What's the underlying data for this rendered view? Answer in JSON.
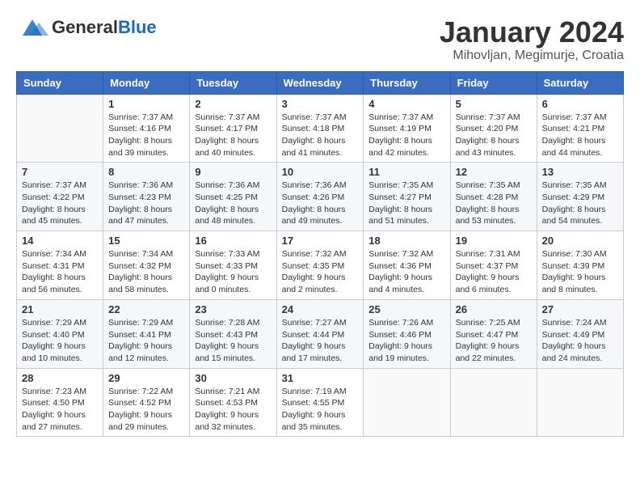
{
  "header": {
    "logo_general": "General",
    "logo_blue": "Blue",
    "title": "January 2024",
    "subtitle": "Mihovljan, Megimurje, Croatia"
  },
  "calendar": {
    "days_of_week": [
      "Sunday",
      "Monday",
      "Tuesday",
      "Wednesday",
      "Thursday",
      "Friday",
      "Saturday"
    ],
    "weeks": [
      [
        {
          "day": "",
          "info": ""
        },
        {
          "day": "1",
          "info": "Sunrise: 7:37 AM\nSunset: 4:16 PM\nDaylight: 8 hours\nand 39 minutes."
        },
        {
          "day": "2",
          "info": "Sunrise: 7:37 AM\nSunset: 4:17 PM\nDaylight: 8 hours\nand 40 minutes."
        },
        {
          "day": "3",
          "info": "Sunrise: 7:37 AM\nSunset: 4:18 PM\nDaylight: 8 hours\nand 41 minutes."
        },
        {
          "day": "4",
          "info": "Sunrise: 7:37 AM\nSunset: 4:19 PM\nDaylight: 8 hours\nand 42 minutes."
        },
        {
          "day": "5",
          "info": "Sunrise: 7:37 AM\nSunset: 4:20 PM\nDaylight: 8 hours\nand 43 minutes."
        },
        {
          "day": "6",
          "info": "Sunrise: 7:37 AM\nSunset: 4:21 PM\nDaylight: 8 hours\nand 44 minutes."
        }
      ],
      [
        {
          "day": "7",
          "info": "Sunrise: 7:37 AM\nSunset: 4:22 PM\nDaylight: 8 hours\nand 45 minutes."
        },
        {
          "day": "8",
          "info": "Sunrise: 7:36 AM\nSunset: 4:23 PM\nDaylight: 8 hours\nand 47 minutes."
        },
        {
          "day": "9",
          "info": "Sunrise: 7:36 AM\nSunset: 4:25 PM\nDaylight: 8 hours\nand 48 minutes."
        },
        {
          "day": "10",
          "info": "Sunrise: 7:36 AM\nSunset: 4:26 PM\nDaylight: 8 hours\nand 49 minutes."
        },
        {
          "day": "11",
          "info": "Sunrise: 7:35 AM\nSunset: 4:27 PM\nDaylight: 8 hours\nand 51 minutes."
        },
        {
          "day": "12",
          "info": "Sunrise: 7:35 AM\nSunset: 4:28 PM\nDaylight: 8 hours\nand 53 minutes."
        },
        {
          "day": "13",
          "info": "Sunrise: 7:35 AM\nSunset: 4:29 PM\nDaylight: 8 hours\nand 54 minutes."
        }
      ],
      [
        {
          "day": "14",
          "info": "Sunrise: 7:34 AM\nSunset: 4:31 PM\nDaylight: 8 hours\nand 56 minutes."
        },
        {
          "day": "15",
          "info": "Sunrise: 7:34 AM\nSunset: 4:32 PM\nDaylight: 8 hours\nand 58 minutes."
        },
        {
          "day": "16",
          "info": "Sunrise: 7:33 AM\nSunset: 4:33 PM\nDaylight: 9 hours\nand 0 minutes."
        },
        {
          "day": "17",
          "info": "Sunrise: 7:32 AM\nSunset: 4:35 PM\nDaylight: 9 hours\nand 2 minutes."
        },
        {
          "day": "18",
          "info": "Sunrise: 7:32 AM\nSunset: 4:36 PM\nDaylight: 9 hours\nand 4 minutes."
        },
        {
          "day": "19",
          "info": "Sunrise: 7:31 AM\nSunset: 4:37 PM\nDaylight: 9 hours\nand 6 minutes."
        },
        {
          "day": "20",
          "info": "Sunrise: 7:30 AM\nSunset: 4:39 PM\nDaylight: 9 hours\nand 8 minutes."
        }
      ],
      [
        {
          "day": "21",
          "info": "Sunrise: 7:29 AM\nSunset: 4:40 PM\nDaylight: 9 hours\nand 10 minutes."
        },
        {
          "day": "22",
          "info": "Sunrise: 7:29 AM\nSunset: 4:41 PM\nDaylight: 9 hours\nand 12 minutes."
        },
        {
          "day": "23",
          "info": "Sunrise: 7:28 AM\nSunset: 4:43 PM\nDaylight: 9 hours\nand 15 minutes."
        },
        {
          "day": "24",
          "info": "Sunrise: 7:27 AM\nSunset: 4:44 PM\nDaylight: 9 hours\nand 17 minutes."
        },
        {
          "day": "25",
          "info": "Sunrise: 7:26 AM\nSunset: 4:46 PM\nDaylight: 9 hours\nand 19 minutes."
        },
        {
          "day": "26",
          "info": "Sunrise: 7:25 AM\nSunset: 4:47 PM\nDaylight: 9 hours\nand 22 minutes."
        },
        {
          "day": "27",
          "info": "Sunrise: 7:24 AM\nSunset: 4:49 PM\nDaylight: 9 hours\nand 24 minutes."
        }
      ],
      [
        {
          "day": "28",
          "info": "Sunrise: 7:23 AM\nSunset: 4:50 PM\nDaylight: 9 hours\nand 27 minutes."
        },
        {
          "day": "29",
          "info": "Sunrise: 7:22 AM\nSunset: 4:52 PM\nDaylight: 9 hours\nand 29 minutes."
        },
        {
          "day": "30",
          "info": "Sunrise: 7:21 AM\nSunset: 4:53 PM\nDaylight: 9 hours\nand 32 minutes."
        },
        {
          "day": "31",
          "info": "Sunrise: 7:19 AM\nSunset: 4:55 PM\nDaylight: 9 hours\nand 35 minutes."
        },
        {
          "day": "",
          "info": ""
        },
        {
          "day": "",
          "info": ""
        },
        {
          "day": "",
          "info": ""
        }
      ]
    ]
  }
}
